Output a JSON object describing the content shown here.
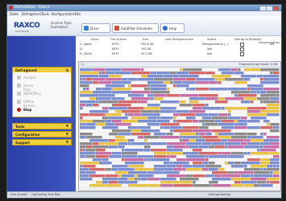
{
  "titlebar": {
    "title": "PerfectDisk - Raxco"
  },
  "menubar": {
    "items": [
      "Datei",
      "Defragment",
      "Tools",
      "Konfiguration",
      "Hilfe"
    ]
  },
  "toolbar": {
    "logo": "RAXCO",
    "logo_sub": "SOFTWARE",
    "license_label": "License Type:",
    "license_value": "Evaluation",
    "tabs": [
      {
        "label": "Drive",
        "icon": "drive-icon",
        "color": "#3b7fd1"
      },
      {
        "label": "AutoPilot Scheduler",
        "icon": "calendar-icon",
        "color": "#d14b3b"
      },
      {
        "label": "Help",
        "icon": "help-icon",
        "color": "#2d6fd0"
      }
    ]
  },
  "sidebar": {
    "defragment_header": "Defragment",
    "items": [
      {
        "label": "Analyze",
        "active": false
      },
      {
        "label": "Smart Prep",
        "active": false
      },
      {
        "label": "SMARTPlus",
        "active": false
      },
      {
        "label": "Offline System Files",
        "active": false
      },
      {
        "label": "Stop",
        "active": true
      }
    ],
    "collapsed": [
      "Tools",
      "Configuration",
      "Support"
    ]
  },
  "drives": {
    "headers": [
      "Drive",
      "File System",
      "Size",
      "Last Defragmented",
      "Status",
      "Defrag at Reboot",
      "% Fragmentation"
    ],
    "rows": [
      {
        "drive": "C: (data)",
        "fs": "NTFS",
        "size": "232.8 GB",
        "last": "",
        "status": "Defragmenting (...)",
        "frag": "6.6"
      },
      {
        "drive": "D:",
        "fs": "NTFS",
        "size": "150 GB",
        "last": "",
        "status": "Idle",
        "frag": ""
      },
      {
        "drive": "E: (Stuff)",
        "fs": "NTFS",
        "size": "93.7 GB",
        "last": "",
        "status": "Idle",
        "frag": ""
      }
    ]
  },
  "map": {
    "drive_label": "C:",
    "progress_text": "Fragments per block: 2.08",
    "colors": {
      "free": "#f6f6f6",
      "file": "#7b8fd1",
      "fragmented": "#d46a6a",
      "system": "#e8c344",
      "dir": "#8c8c8c",
      "excluded": "#c76fa8"
    }
  },
  "statusbar": {
    "left_tab": "Live Screen",
    "left_text": "Optimizing free files",
    "right_text": "Defragmenting"
  }
}
